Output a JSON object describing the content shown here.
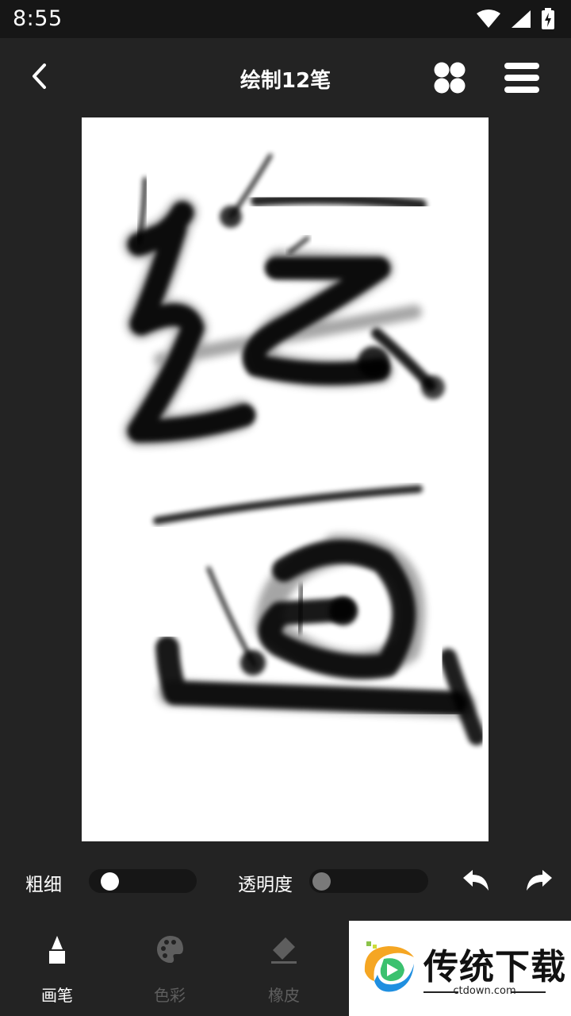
{
  "status_bar": {
    "time": "8:55",
    "icons": [
      "wifi-icon",
      "signal-icon",
      "battery-charging-icon"
    ]
  },
  "header": {
    "title": "绘制12笔",
    "back_icon": "chevron-left-icon",
    "grid_icon": "four-circles-icon",
    "menu_icon": "hamburger-menu-icon"
  },
  "canvas": {
    "background": "#ffffff",
    "ink_color": "#000000",
    "stroke_count": 12
  },
  "controls": {
    "thickness_label": "粗细",
    "thickness_value": 0.1,
    "opacity_label": "透明度",
    "opacity_value": 0.0,
    "undo_icon": "undo-icon",
    "redo_icon": "redo-icon"
  },
  "tabs": [
    {
      "label": "画笔",
      "icon": "brush-icon",
      "active": true
    },
    {
      "label": "色彩",
      "icon": "palette-icon",
      "active": false
    },
    {
      "label": "橡皮",
      "icon": "eraser-icon",
      "active": false
    }
  ],
  "watermark": {
    "title": "传统下载",
    "url": "ctdown.com"
  },
  "colors": {
    "background": "#232323",
    "status_bar": "#161616",
    "active": "#ffffff",
    "inactive": "#5e5e5e"
  }
}
